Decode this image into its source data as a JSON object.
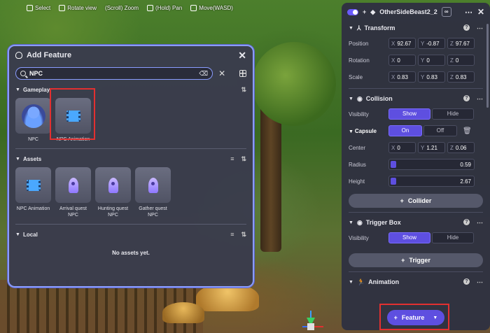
{
  "toolbar": {
    "select": "Select",
    "rotate": "Rotate view",
    "zoom": "(Scroll) Zoom",
    "pan": "(Hold) Pan",
    "move": "Move(WASD)"
  },
  "add_feature": {
    "title": "Add Feature",
    "search_value": "NPC",
    "gameplay": {
      "title": "Gameplay",
      "items": [
        {
          "label": "NPC"
        },
        {
          "label": "NPC Animation"
        }
      ]
    },
    "assets": {
      "title": "Assets",
      "items": [
        {
          "label": "NPC Animation"
        },
        {
          "label": "Arrival quest NPC"
        },
        {
          "label": "Hunting quest NPC"
        },
        {
          "label": "Gather quest NPC"
        }
      ]
    },
    "local": {
      "title": "Local",
      "empty_text": "No assets yet."
    }
  },
  "inspector": {
    "object_name": "OtherSideBeast2_2",
    "transform": {
      "title": "Transform",
      "position": {
        "label": "Position",
        "x": "92.67",
        "y": "-0.87",
        "z": "97.67"
      },
      "rotation": {
        "label": "Rotation",
        "x": "0",
        "y": "0",
        "z": "0"
      },
      "scale": {
        "label": "Scale",
        "x": "0.83",
        "y": "0.83",
        "z": "0.83"
      }
    },
    "collision": {
      "title": "Collision",
      "visibility_label": "Visibility",
      "show": "Show",
      "hide": "Hide",
      "capsule": {
        "title": "Capsule",
        "on": "On",
        "off": "Off",
        "center_label": "Center",
        "center": {
          "x": "0",
          "y": "1.21",
          "z": "0.06"
        },
        "radius_label": "Radius",
        "radius": "0.59",
        "height_label": "Height",
        "height": "2.67"
      },
      "add_collider": "Collider"
    },
    "trigger_box": {
      "title": "Trigger Box",
      "visibility_label": "Visibility",
      "show": "Show",
      "hide": "Hide",
      "add_trigger": "Trigger"
    },
    "animation": {
      "title": "Animation",
      "feature_button": "Feature"
    }
  },
  "colors": {
    "accent": "#5e4fe0",
    "highlight": "#e23030"
  }
}
